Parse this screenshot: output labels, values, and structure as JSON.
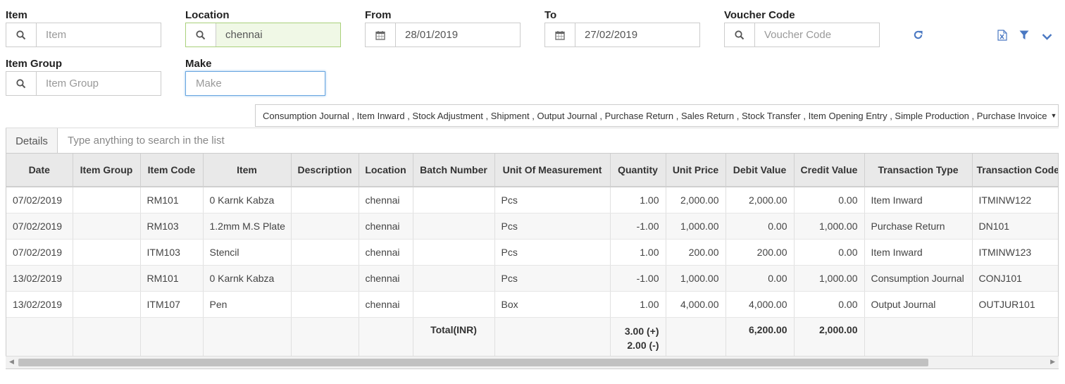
{
  "filters": {
    "item": {
      "label": "Item",
      "value": "",
      "placeholder": "Item"
    },
    "location": {
      "label": "Location",
      "value": "chennai",
      "placeholder": ""
    },
    "from": {
      "label": "From",
      "value": "28/01/2019"
    },
    "to": {
      "label": "To",
      "value": "27/02/2019"
    },
    "voucher": {
      "label": "Voucher Code",
      "value": "",
      "placeholder": "Voucher Code"
    },
    "item_group": {
      "label": "Item Group",
      "value": "",
      "placeholder": "Item Group"
    },
    "make": {
      "label": "Make",
      "value": "",
      "placeholder": "Make"
    }
  },
  "transaction_types": "Consumption Journal , Item Inward , Stock Adjustment , Shipment , Output Journal , Purchase Return , Sales Return , Stock Transfer , Item Opening Entry , Simple Production , Purchase Invoice",
  "tab_details": "Details",
  "search_placeholder": "Type anything to search in the list",
  "columns": [
    "Date",
    "Item Group",
    "Item Code",
    "Item",
    "Description",
    "Location",
    "Batch Number",
    "Unit Of Measurement",
    "Quantity",
    "Unit Price",
    "Debit Value",
    "Credit Value",
    "Transaction Type",
    "Transaction Code"
  ],
  "rows": [
    [
      "07/02/2019",
      "",
      "RM101",
      "0 Karnk Kabza",
      "",
      "chennai",
      "",
      "Pcs",
      "1.00",
      "2,000.00",
      "2,000.00",
      "0.00",
      "Item Inward",
      "ITMINW122"
    ],
    [
      "07/02/2019",
      "",
      "RM103",
      "1.2mm M.S Plate",
      "",
      "chennai",
      "",
      "Pcs",
      "-1.00",
      "1,000.00",
      "0.00",
      "1,000.00",
      "Purchase Return",
      "DN101"
    ],
    [
      "07/02/2019",
      "",
      "ITM103",
      "Stencil",
      "",
      "chennai",
      "",
      "Pcs",
      "1.00",
      "200.00",
      "200.00",
      "0.00",
      "Item Inward",
      "ITMINW123"
    ],
    [
      "13/02/2019",
      "",
      "RM101",
      "0 Karnk Kabza",
      "",
      "chennai",
      "",
      "Pcs",
      "-1.00",
      "1,000.00",
      "0.00",
      "1,000.00",
      "Consumption Journal",
      "CONJ101"
    ],
    [
      "13/02/2019",
      "",
      "ITM107",
      "Pen",
      "",
      "chennai",
      "",
      "Box",
      "1.00",
      "4,000.00",
      "4,000.00",
      "0.00",
      "Output Journal",
      "OUTJUR101"
    ]
  ],
  "totals": {
    "label": "Total(INR)",
    "qty_plus": "3.00 (+)",
    "qty_minus": "2.00 (-)",
    "debit": "6,200.00",
    "credit": "2,000.00"
  },
  "icons": {
    "search": "search-icon",
    "calendar": "calendar-icon",
    "refresh": "refresh-icon",
    "excel": "excel-export-icon",
    "filter": "filter-icon",
    "chevron": "chevron-down-icon"
  },
  "colors": {
    "accent": "#4a78c2",
    "location_bg": "#f0f8e6",
    "header_bg": "#e9e9e9"
  }
}
